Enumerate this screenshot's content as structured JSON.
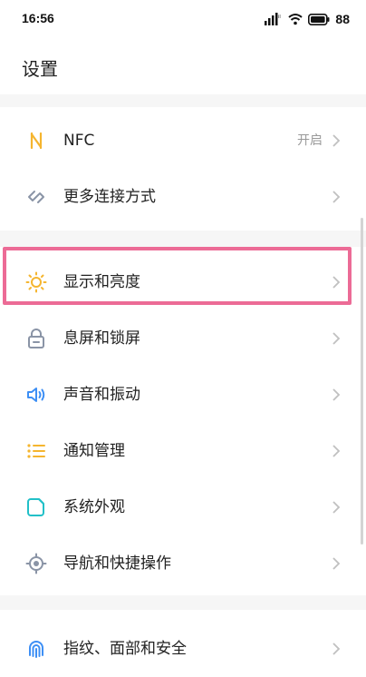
{
  "status": {
    "time": "16:56",
    "battery": "88"
  },
  "header": {
    "title": "设置"
  },
  "items": [
    {
      "label": "NFC",
      "value": "开启",
      "icon": "nfc-icon",
      "color": "#f5b52f"
    },
    {
      "label": "更多连接方式",
      "icon": "link-icon",
      "color": "#8a94a6"
    },
    {
      "label": "显示和亮度",
      "icon": "sun-icon",
      "color": "#f5b52f"
    },
    {
      "label": "息屏和锁屏",
      "icon": "lock-icon",
      "color": "#8a94a6"
    },
    {
      "label": "声音和振动",
      "icon": "speaker-icon",
      "color": "#3d8ff5"
    },
    {
      "label": "通知管理",
      "icon": "list-icon",
      "color": "#f5b52f"
    },
    {
      "label": "系统外观",
      "icon": "appearance-icon",
      "color": "#22c0c8"
    },
    {
      "label": "导航和快捷操作",
      "icon": "navigation-icon",
      "color": "#8a94a6"
    },
    {
      "label": "指纹、面部和安全",
      "icon": "fingerprint-icon",
      "color": "#3d8ff5"
    }
  ],
  "colors": {
    "highlight": "#ec6b96",
    "chevron": "#c0c0c0"
  }
}
